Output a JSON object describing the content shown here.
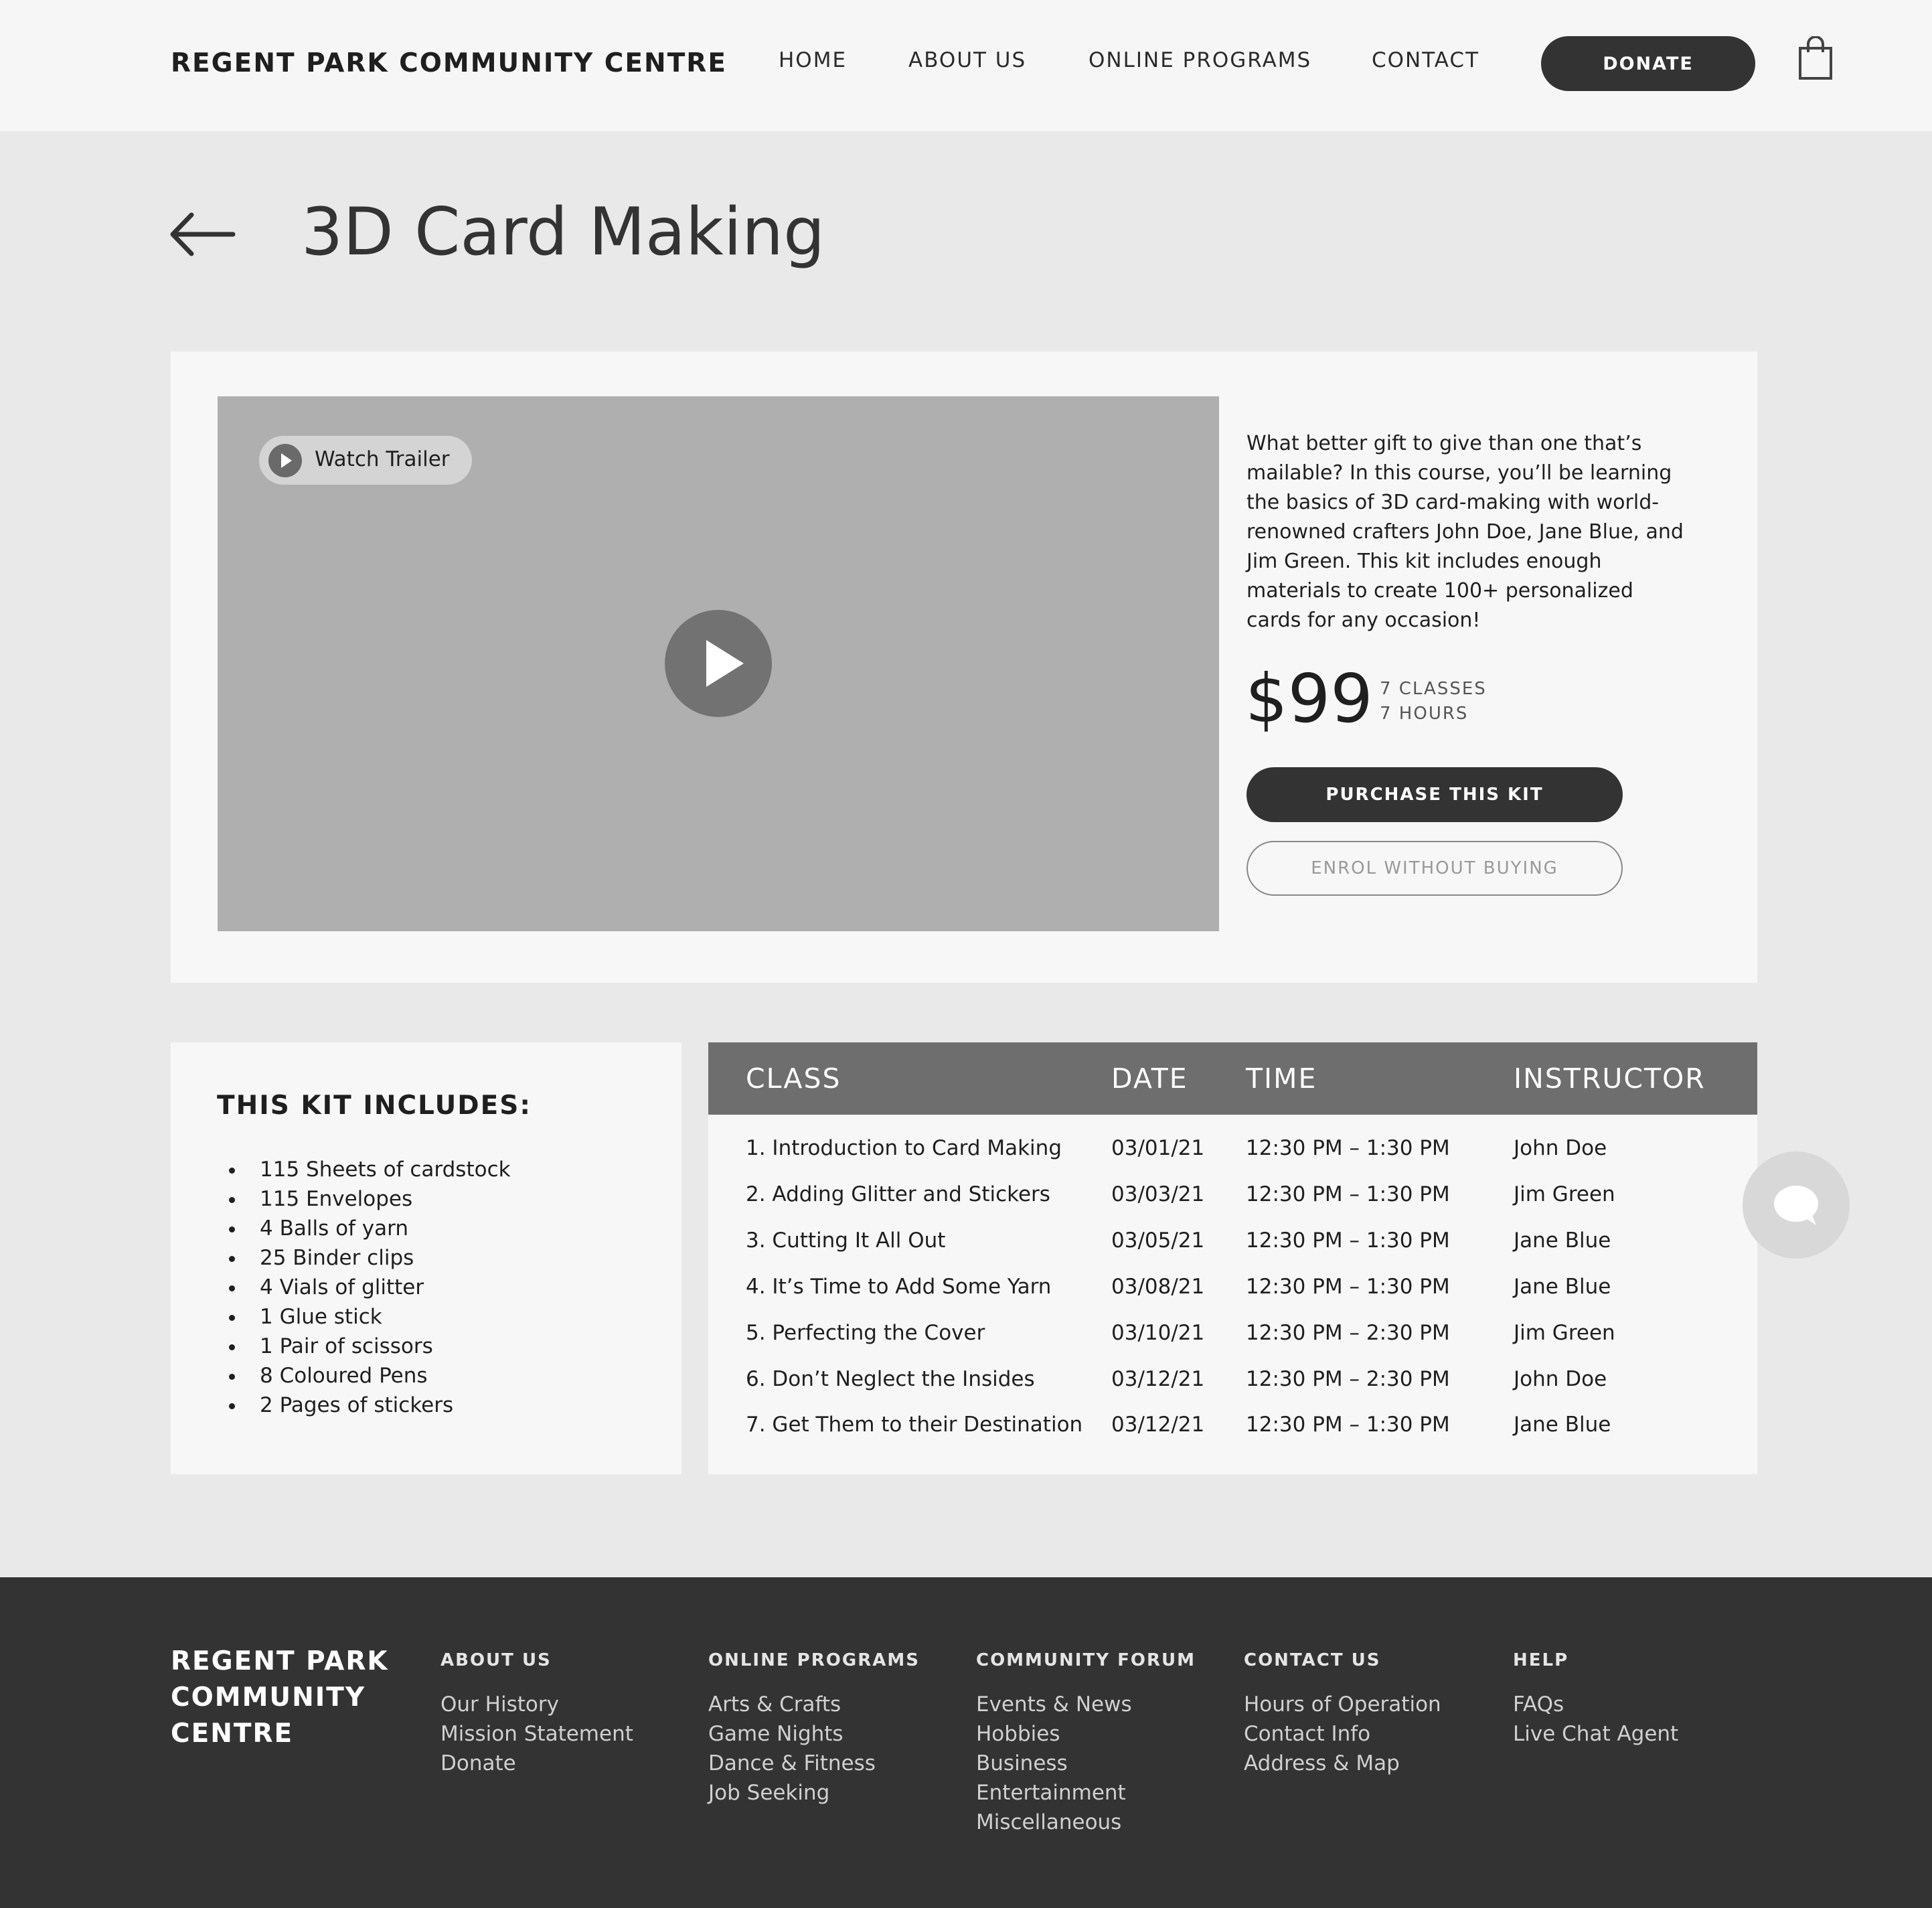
{
  "header": {
    "brand": "REGENT PARK COMMUNITY CENTRE",
    "nav": [
      "HOME",
      "ABOUT US",
      "ONLINE PROGRAMS",
      "CONTACT"
    ],
    "donate_label": "DONATE",
    "cart_icon": "shopping-bag-icon"
  },
  "page": {
    "back_icon": "arrow-left-icon",
    "title": "3D Card Making"
  },
  "hero": {
    "trailer_label": "Watch Trailer",
    "trailer_icon": "play-circle-icon",
    "play_icon": "play-icon",
    "description": "What better gift to give than one that’s mailable? In this course, you’ll be learning the basics of 3D card-making with world-renowned crafters John Doe, Jane Blue, and Jim Green. This kit includes enough materials to create 100+ personalized cards for any occasion!",
    "price": "$99",
    "classes": "7 CLASSES",
    "hours": "7 HOURS",
    "purchase_label": "PURCHASE THIS KIT",
    "enrol_label": "ENROL WITHOUT BUYING"
  },
  "kit": {
    "title": "THIS KIT INCLUDES:",
    "items": [
      "115 Sheets of cardstock",
      "115 Envelopes",
      "4 Balls of yarn",
      "25 Binder clips",
      "4 Vials of glitter",
      "1 Glue stick",
      "1 Pair of scissors",
      "8 Coloured Pens",
      "2 Pages of stickers"
    ]
  },
  "schedule": {
    "headers": [
      "CLASS",
      "DATE",
      "TIME",
      "INSTRUCTOR"
    ],
    "rows": [
      [
        "1. Introduction to Card Making",
        "03/01/21",
        "12:30 PM – 1:30 PM",
        "John Doe"
      ],
      [
        "2. Adding Glitter and Stickers",
        "03/03/21",
        "12:30 PM – 1:30 PM",
        "Jim Green"
      ],
      [
        "3. Cutting It All Out",
        "03/05/21",
        "12:30 PM – 1:30 PM",
        "Jane Blue"
      ],
      [
        "4. It’s Time to Add Some Yarn",
        "03/08/21",
        "12:30 PM – 1:30 PM",
        "Jane Blue"
      ],
      [
        "5. Perfecting the Cover",
        "03/10/21",
        "12:30 PM – 2:30 PM",
        "Jim Green"
      ],
      [
        "6. Don’t Neglect the Insides",
        "03/12/21",
        "12:30 PM – 2:30 PM",
        "John Doe"
      ],
      [
        "7. Get Them to their Destination",
        "03/12/21",
        "12:30 PM – 1:30 PM",
        "Jane Blue"
      ]
    ]
  },
  "chat": {
    "icon": "chat-bubble-icon"
  },
  "footer": {
    "brand": "REGENT PARK COMMUNITY CENTRE",
    "columns": [
      {
        "title": "ABOUT US",
        "links": [
          "Our History",
          "Mission Statement",
          "Donate"
        ]
      },
      {
        "title": "ONLINE PROGRAMS",
        "links": [
          "Arts & Crafts",
          "Game Nights",
          "Dance & Fitness",
          "Job Seeking"
        ]
      },
      {
        "title": "COMMUNITY FORUM",
        "links": [
          "Events & News",
          "Hobbies",
          "Business",
          "Entertainment",
          "Miscellaneous"
        ]
      },
      {
        "title": "CONTACT US",
        "links": [
          "Hours of Operation",
          "Contact Info",
          "Address & Map"
        ]
      },
      {
        "title": "HELP",
        "links": [
          "FAQs",
          "Live Chat Agent"
        ]
      }
    ]
  }
}
